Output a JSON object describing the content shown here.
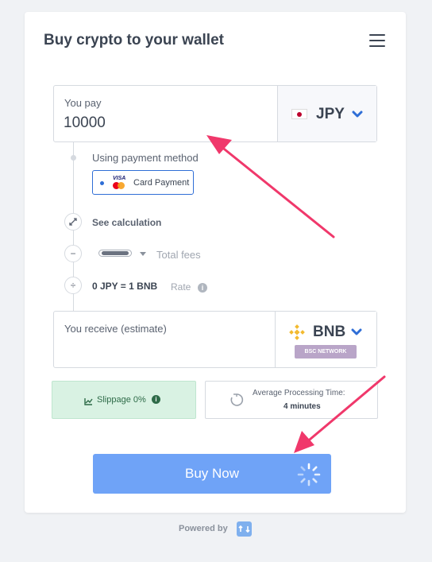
{
  "header": {
    "title": "Buy crypto to your wallet",
    "menu_icon": "hamburger-menu-icon"
  },
  "pay": {
    "label": "You pay",
    "value": "10000",
    "currency": "JPY",
    "flag_icon": "japan-flag-icon"
  },
  "payment_method": {
    "label": "Using payment method",
    "selected": "Card Payment",
    "icon": "visa-mastercard-icon"
  },
  "calculation": {
    "see_calculation": "See calculation",
    "total_fees": "Total fees",
    "rate_value": "0 JPY = 1 BNB",
    "rate_label": "Rate",
    "info_icon": "i"
  },
  "receive": {
    "label": "You receive (estimate)",
    "currency": "BNB",
    "network": "BSC NETWORK",
    "coin_icon": "bnb-logo-icon"
  },
  "slippage": {
    "label": "Slippage 0%",
    "info": "i"
  },
  "processing": {
    "label": "Average Processing Time:",
    "time": "4 minutes"
  },
  "buy_button": {
    "label": "Buy Now"
  },
  "footer": {
    "powered_by": "Powered by"
  },
  "colors": {
    "accent": "#2f6ed6",
    "button": "#6fa3f7",
    "annotation_arrow": "#f0386b",
    "slippage_bg": "#d9f2e3"
  }
}
